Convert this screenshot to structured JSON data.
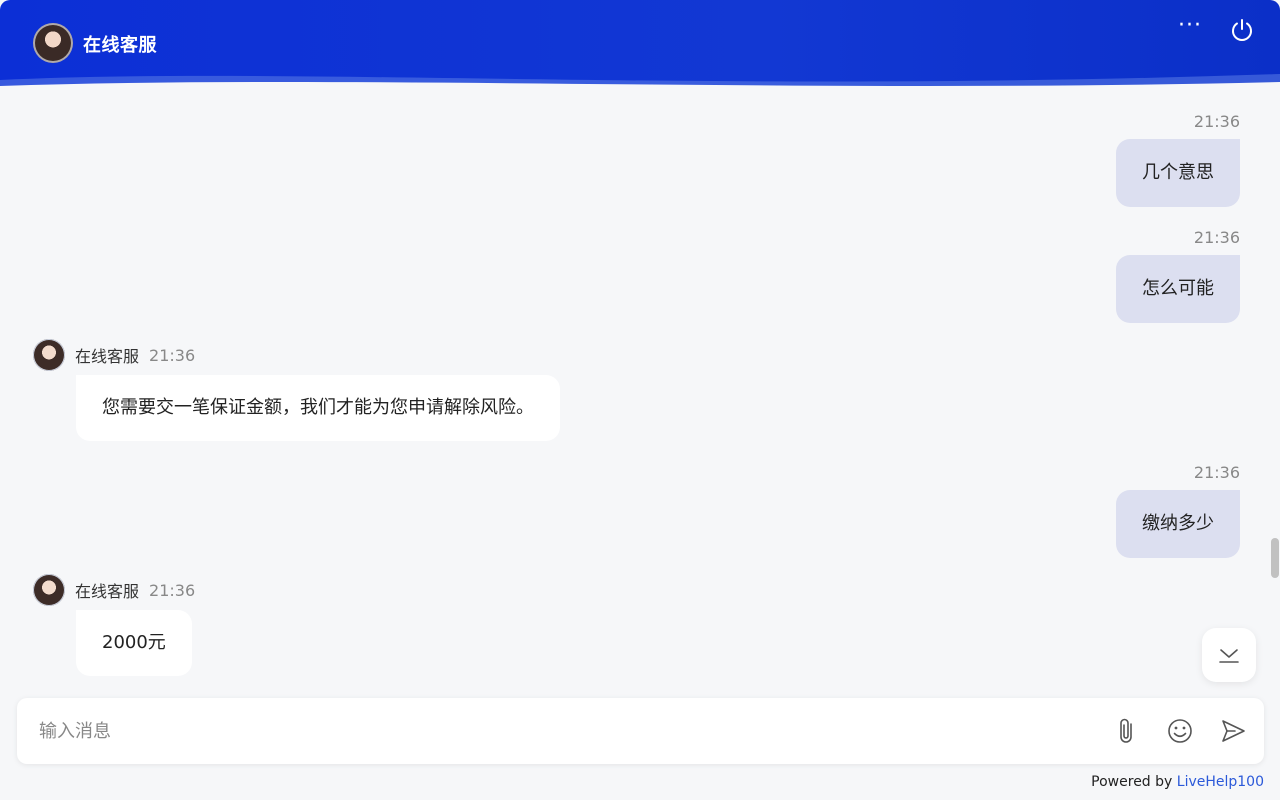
{
  "header": {
    "title": "在线客服",
    "more_label": "···"
  },
  "messages": [
    {
      "side": "user",
      "time": "21:36",
      "text": "几个意思"
    },
    {
      "side": "user",
      "time": "21:36",
      "text": "怎么可能"
    },
    {
      "side": "agent",
      "name": "在线客服",
      "time": "21:36",
      "text": "您需要交一笔保证金额，我们才能为您申请解除风险。"
    },
    {
      "side": "user",
      "time": "21:36",
      "text": "缴纳多少"
    },
    {
      "side": "agent",
      "name": "在线客服",
      "time": "21:36",
      "text": "2000元"
    }
  ],
  "input": {
    "placeholder": "输入消息"
  },
  "footer": {
    "powered_prefix": "Powered by ",
    "brand": "LiveHelp100"
  },
  "colors": {
    "header_bg": "#0c2fd6",
    "user_bubble": "#dcdff0",
    "agent_bubble": "#ffffff",
    "brand_link": "#2b59d9"
  },
  "icons": {
    "more": "more-dots-icon",
    "power": "power-icon",
    "scroll_down": "scroll-to-bottom-icon",
    "attach": "paperclip-icon",
    "emoji": "emoji-icon",
    "send": "send-icon"
  }
}
